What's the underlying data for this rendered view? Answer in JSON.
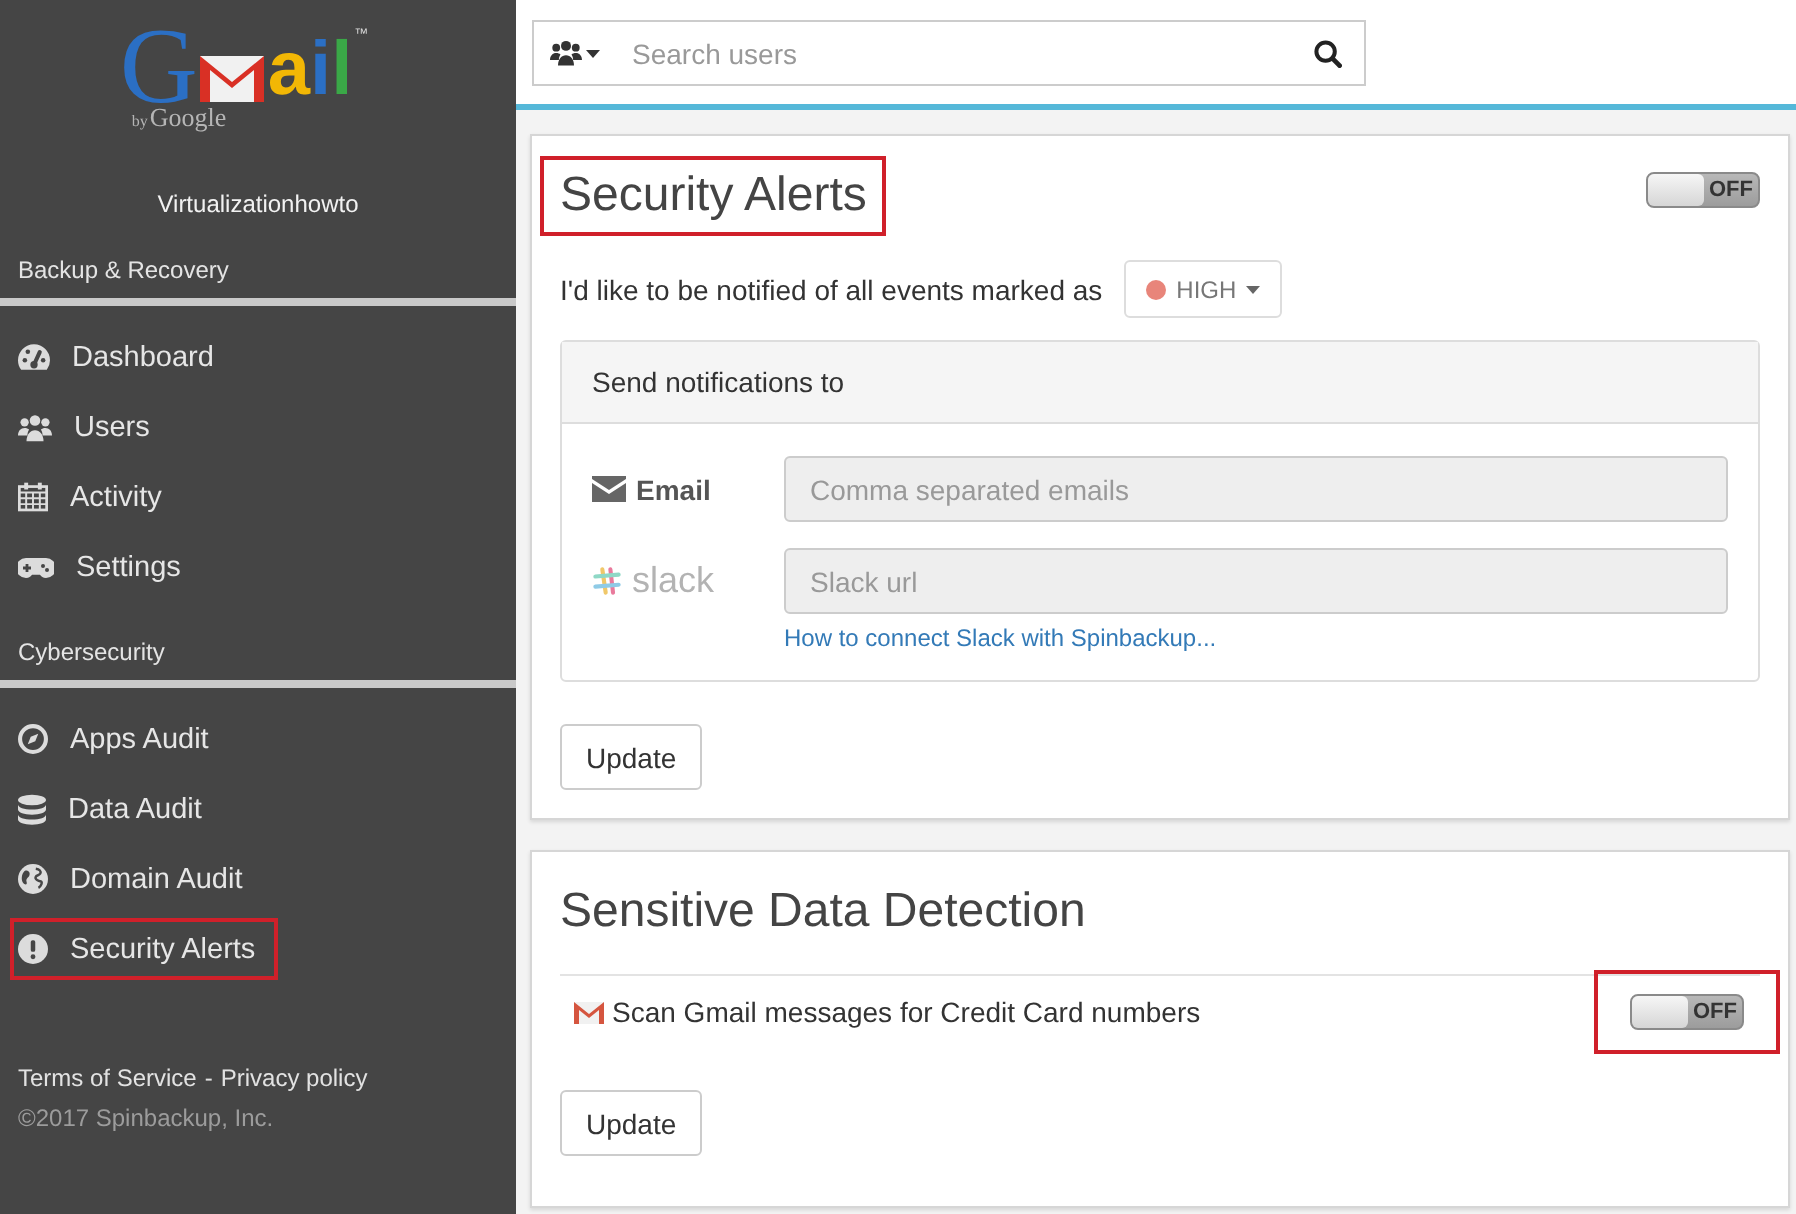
{
  "sidebar": {
    "logo": {
      "letters": [
        {
          "char": "G",
          "color": "#2b6fc4"
        },
        {
          "char": "a",
          "color": "#f2b705"
        },
        {
          "char": "i",
          "color": "#2b6fc4"
        },
        {
          "char": "l",
          "color": "#3aa847"
        }
      ],
      "trademark": "™",
      "byline_prefix": "by",
      "byline": "Google"
    },
    "account": "Virtualizationhowto",
    "sections": [
      {
        "title": "Backup & Recovery",
        "items": [
          {
            "label": "Dashboard",
            "annotated": false
          },
          {
            "label": "Users",
            "annotated": false
          },
          {
            "label": "Activity",
            "annotated": false
          },
          {
            "label": "Settings",
            "annotated": false
          }
        ]
      },
      {
        "title": "Cybersecurity",
        "items": [
          {
            "label": "Apps Audit",
            "annotated": false
          },
          {
            "label": "Data Audit",
            "annotated": false
          },
          {
            "label": "Domain Audit",
            "annotated": false
          },
          {
            "label": "Security Alerts",
            "annotated": true
          }
        ]
      }
    ],
    "footer": {
      "links": [
        "Terms of Service",
        "Privacy policy"
      ],
      "separator": "-",
      "copyright": "©2017 Spinbackup, Inc."
    }
  },
  "search": {
    "placeholder": "Search users"
  },
  "security_alerts": {
    "title": "Security Alerts",
    "title_annotated": true,
    "toggle": {
      "on": false,
      "label": "OFF"
    },
    "prompt": "I'd like to be notified of all events marked as",
    "severity": "HIGH",
    "notifications": {
      "title": "Send notifications to",
      "channels": [
        {
          "kind": "email",
          "label": "Email",
          "placeholder": "Comma separated emails"
        },
        {
          "kind": "slack",
          "label": "slack",
          "placeholder": "Slack url",
          "help_link": "How to connect Slack with Spinbackup..."
        }
      ]
    },
    "button": "Update"
  },
  "sensitive_data": {
    "title": "Sensitive Data Detection",
    "rows": [
      {
        "label": "Scan Gmail messages for Credit Card numbers",
        "annotated": true,
        "toggle": {
          "on": false,
          "label": "OFF"
        }
      }
    ],
    "button": "Update"
  }
}
